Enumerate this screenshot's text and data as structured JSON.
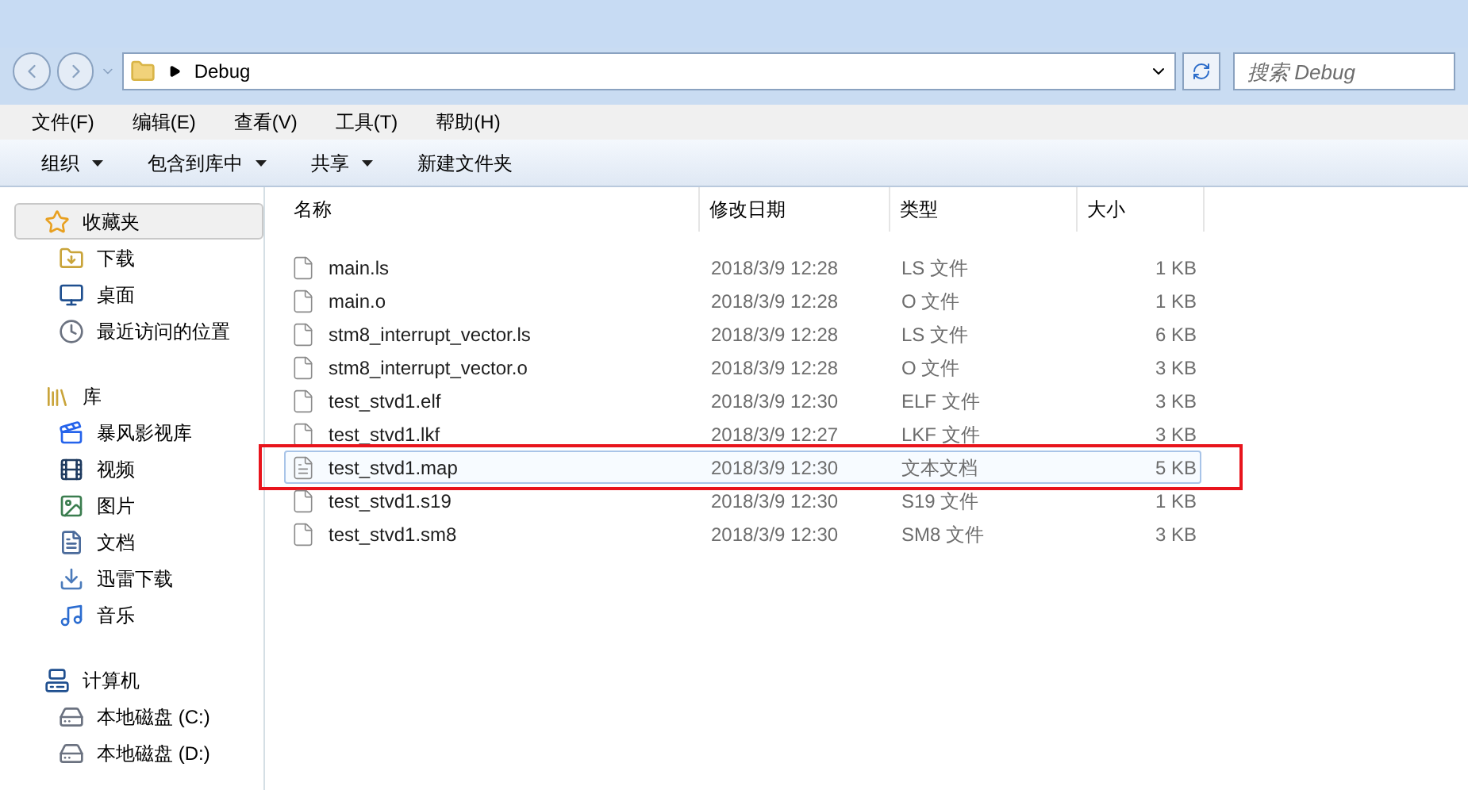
{
  "address_bar": {
    "path": "Debug",
    "search_placeholder": "搜索 Debug"
  },
  "menu_bar": [
    "文件(F)",
    "编辑(E)",
    "查看(V)",
    "工具(T)",
    "帮助(H)"
  ],
  "toolbar": [
    {
      "label": "组织",
      "dropdown": true
    },
    {
      "label": "包含到库中",
      "dropdown": true
    },
    {
      "label": "共享",
      "dropdown": true
    },
    {
      "label": "新建文件夹",
      "dropdown": false
    }
  ],
  "sidebar": [
    {
      "label": "收藏夹",
      "kind": "star",
      "selected": true,
      "children": [
        {
          "label": "下载",
          "kind": "download"
        },
        {
          "label": "桌面",
          "kind": "desktop"
        },
        {
          "label": "最近访问的位置",
          "kind": "recent"
        }
      ]
    },
    {
      "label": "库",
      "kind": "library",
      "selected": false,
      "children": [
        {
          "label": "暴风影视库",
          "kind": "video"
        },
        {
          "label": "视频",
          "kind": "film"
        },
        {
          "label": "图片",
          "kind": "image"
        },
        {
          "label": "文档",
          "kind": "document"
        },
        {
          "label": "迅雷下载",
          "kind": "download2"
        },
        {
          "label": "音乐",
          "kind": "music"
        }
      ]
    },
    {
      "label": "计算机",
      "kind": "computer",
      "selected": false,
      "children": [
        {
          "label": "本地磁盘 (C:)",
          "kind": "drive"
        },
        {
          "label": "本地磁盘 (D:)",
          "kind": "drive"
        }
      ]
    }
  ],
  "table": {
    "columns": [
      "名称",
      "修改日期",
      "类型",
      "大小"
    ],
    "rows": [
      {
        "name": "main.ls",
        "date": "2018/3/9 12:28",
        "type": "LS 文件",
        "size": "1 KB",
        "hovered": false,
        "marked": false
      },
      {
        "name": "main.o",
        "date": "2018/3/9 12:28",
        "type": "O 文件",
        "size": "1 KB",
        "hovered": false,
        "marked": false
      },
      {
        "name": "stm8_interrupt_vector.ls",
        "date": "2018/3/9 12:28",
        "type": "LS 文件",
        "size": "6 KB",
        "hovered": false,
        "marked": false
      },
      {
        "name": "stm8_interrupt_vector.o",
        "date": "2018/3/9 12:28",
        "type": "O 文件",
        "size": "3 KB",
        "hovered": false,
        "marked": false
      },
      {
        "name": "test_stvd1.elf",
        "date": "2018/3/9 12:30",
        "type": "ELF 文件",
        "size": "3 KB",
        "hovered": false,
        "marked": false
      },
      {
        "name": "test_stvd1.lkf",
        "date": "2018/3/9 12:27",
        "type": "LKF 文件",
        "size": "3 KB",
        "hovered": false,
        "marked": false
      },
      {
        "name": "test_stvd1.map",
        "date": "2018/3/9 12:30",
        "type": "文本文档",
        "size": "5 KB",
        "hovered": true,
        "marked": true
      },
      {
        "name": "test_stvd1.s19",
        "date": "2018/3/9 12:30",
        "type": "S19 文件",
        "size": "1 KB",
        "hovered": false,
        "marked": false
      },
      {
        "name": "test_stvd1.sm8",
        "date": "2018/3/9 12:30",
        "type": "SM8 文件",
        "size": "3 KB",
        "hovered": false,
        "marked": false
      }
    ]
  }
}
